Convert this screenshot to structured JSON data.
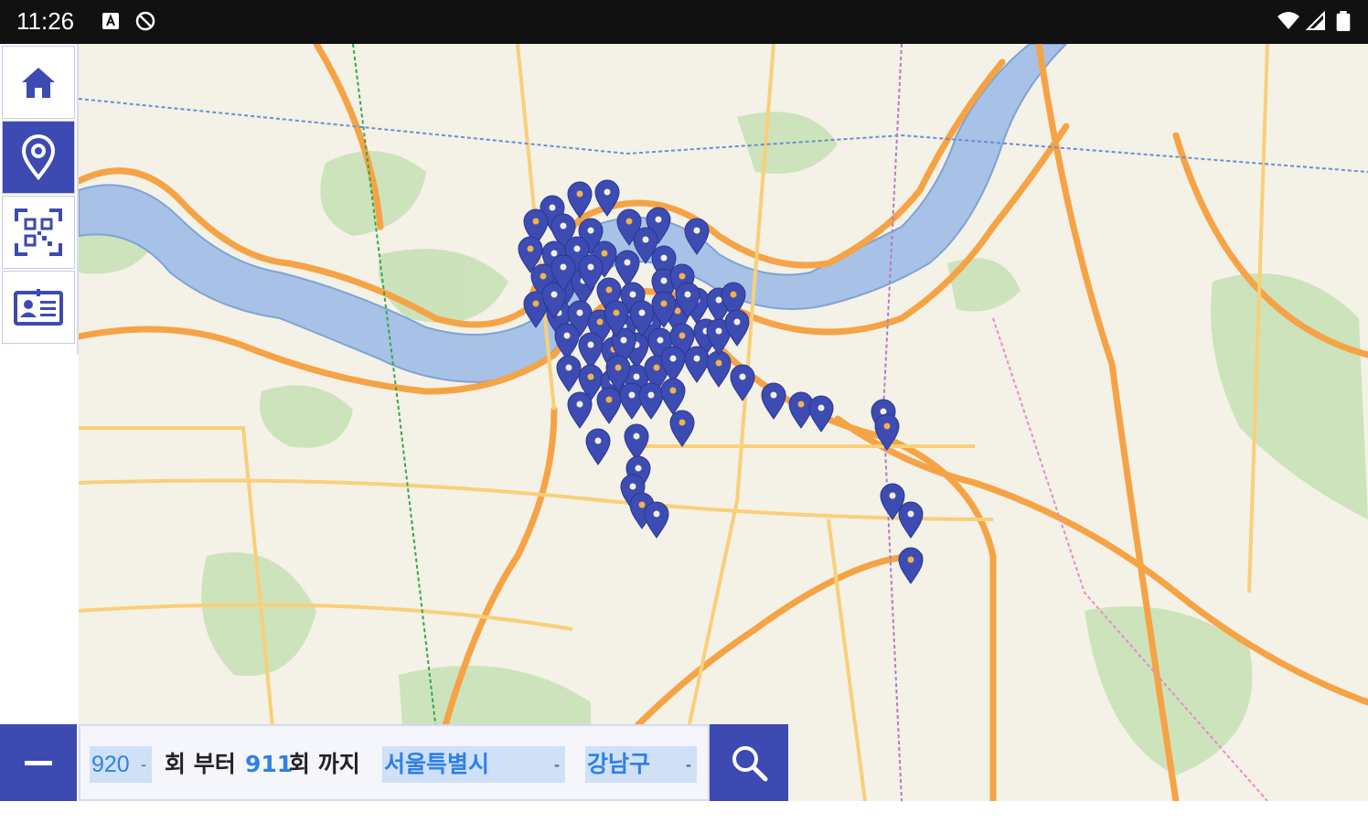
{
  "status_bar": {
    "time": "11:26",
    "icons": [
      "notification-a-icon",
      "sync-blocked-icon"
    ],
    "right_icons": [
      "wifi-icon",
      "signal-icon",
      "battery-icon"
    ]
  },
  "sidebar": {
    "items": [
      {
        "name": "home",
        "icon": "home-icon",
        "active": false
      },
      {
        "name": "map",
        "icon": "location-pin-icon",
        "active": true
      },
      {
        "name": "qr",
        "icon": "qr-scan-icon",
        "active": false
      },
      {
        "name": "profile",
        "icon": "id-card-icon",
        "active": false
      }
    ]
  },
  "filter": {
    "from_round": "920",
    "from_suffix": "회 부터",
    "to_round": "911",
    "to_suffix": "회 까지",
    "city": "서울특별시",
    "district": "강남구",
    "dropdown_arrow": "-"
  },
  "colors": {
    "accent": "#3c4ab1",
    "marker": "#3d4cb2",
    "marker_dot": "#f0b24a",
    "water": "#a7c2e6",
    "road": "#f5a345",
    "park": "#b6d9a5"
  },
  "map": {
    "marker_count": 90
  }
}
